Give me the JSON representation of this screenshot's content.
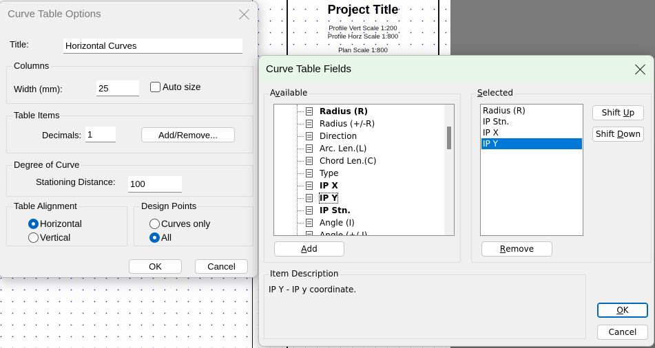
{
  "background": {
    "project_title": "Project Title",
    "scales": [
      "Profile Vert Scale 1:200",
      "Profile Horz Scale 1:800",
      "Plan Scale 1:800"
    ]
  },
  "options_dialog": {
    "title": "Curve Table Options",
    "title_label": "Title:",
    "title_value": "Horizontal Curves",
    "columns": {
      "group_label": "Columns",
      "width_label": "Width (mm):",
      "width_value": "25",
      "auto_size_label": "Auto size",
      "auto_size_checked": false
    },
    "table_items": {
      "group_label": "Table Items",
      "decimals_label": "Decimals:",
      "decimals_value": "1",
      "add_remove_label": "Add/Remove..."
    },
    "degree_of_curve": {
      "group_label": "Degree of Curve",
      "stationing_label": "Stationing Distance:",
      "stationing_value": "100"
    },
    "table_alignment": {
      "group_label": "Table Alignment",
      "options": [
        "Horizontal",
        "Vertical"
      ],
      "selected": "Horizontal"
    },
    "design_points": {
      "group_label": "Design Points",
      "options": [
        "Curves only",
        "All"
      ],
      "selected": "All"
    },
    "ok_label": "OK",
    "cancel_label": "Cancel"
  },
  "fields_dialog": {
    "title": "Curve Table Fields",
    "available": {
      "label_prefix": "A",
      "label_u": "v",
      "label_rest": "ailable",
      "items": [
        {
          "label": "Radius (R)",
          "bold": true
        },
        {
          "label": "Radius (+/-R)",
          "bold": false
        },
        {
          "label": "Direction",
          "bold": false
        },
        {
          "label": "Arc. Len.(L)",
          "bold": false
        },
        {
          "label": "Chord Len.(C)",
          "bold": false
        },
        {
          "label": "Type",
          "bold": false
        },
        {
          "label": "IP X",
          "bold": true
        },
        {
          "label": "IP Y",
          "bold": true,
          "focused": true
        },
        {
          "label": "IP Stn.",
          "bold": true
        },
        {
          "label": "Angle (I)",
          "bold": false
        },
        {
          "label": "Angle (+/-I)",
          "bold": false
        }
      ],
      "add_u": "A",
      "add_rest": "dd"
    },
    "selected": {
      "label_u": "S",
      "label_rest": "elected",
      "items": [
        "Radius (R)",
        "IP Stn.",
        "IP X",
        "IP Y"
      ],
      "active_index": 3,
      "remove_u": "R",
      "remove_rest": "emove",
      "shift_up_prefix": "Shift ",
      "shift_up_u": "U",
      "shift_up_rest": "p",
      "shift_down_prefix": "Shift ",
      "shift_down_u": "D",
      "shift_down_rest": "own"
    },
    "item_description": {
      "group_label": "Item Description",
      "text": "IP Y - IP y coordinate."
    },
    "ok_u": "O",
    "ok_rest": "K",
    "cancel_label": "Cancel"
  }
}
